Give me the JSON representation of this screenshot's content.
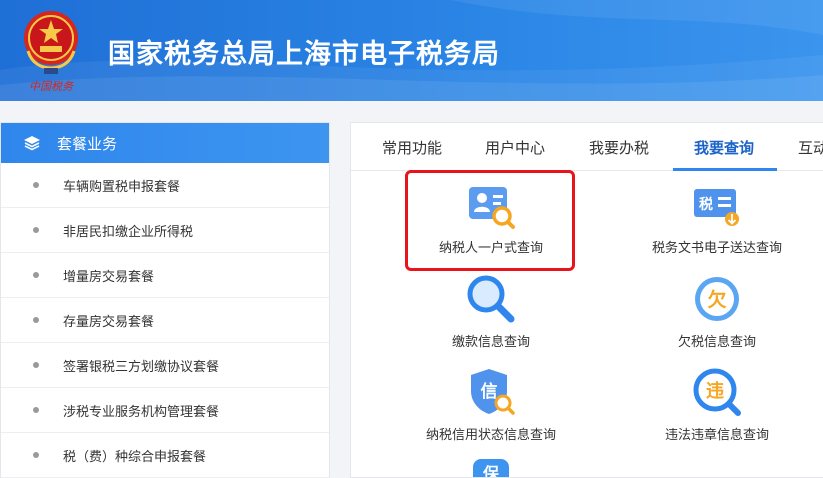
{
  "header": {
    "title": "国家税务总局上海市电子税务局",
    "emblem_caption": "中国税务"
  },
  "sidebar": {
    "heading": "套餐业务",
    "items": [
      "车辆购置税申报套餐",
      "非居民扣缴企业所得税",
      "增量房交易套餐",
      "存量房交易套餐",
      "签署银税三方划缴协议套餐",
      "涉税专业服务机构管理套餐",
      "税（费）种综合申报套餐"
    ]
  },
  "main": {
    "tabs": [
      {
        "label": "常用功能",
        "active": false
      },
      {
        "label": "用户中心",
        "active": false
      },
      {
        "label": "我要办税",
        "active": false
      },
      {
        "label": "我要查询",
        "active": true
      },
      {
        "label": "互动",
        "active": false
      }
    ],
    "services": [
      {
        "label": "纳税人一户式查询",
        "icon": "taxpayer-search-icon",
        "highlighted": true
      },
      {
        "label": "税务文书电子送达查询",
        "icon": "tax-document-delivery-icon"
      },
      {
        "label": "缴款信息查询",
        "icon": "magnifier-icon"
      },
      {
        "label": "欠税信息查询",
        "icon": "arrears-icon"
      },
      {
        "label": "纳税信用状态信息查询",
        "icon": "credit-shield-icon"
      },
      {
        "label": "违法违章信息查询",
        "icon": "violation-search-icon"
      }
    ],
    "icon_glyphs": {
      "tax": "税",
      "arrears": "欠",
      "credit": "信",
      "violation": "违",
      "partial": "保"
    }
  },
  "colors": {
    "header_blue": "#2b86e6",
    "accent_blue": "#2f86ec",
    "active_tab": "#1a63c9",
    "highlight_red": "#e8141b",
    "icon_orange": "#f5a623"
  }
}
